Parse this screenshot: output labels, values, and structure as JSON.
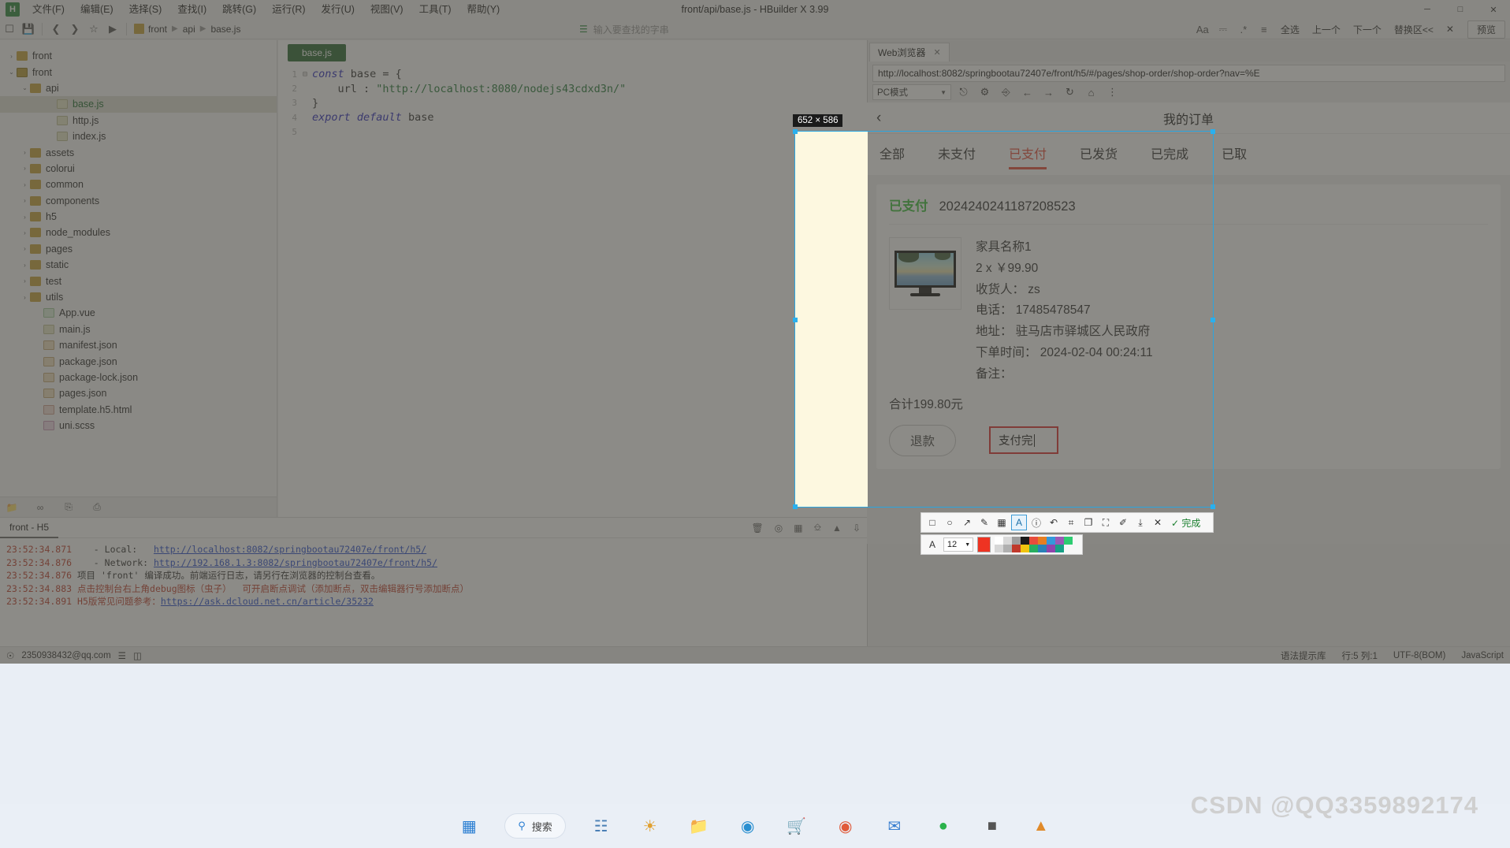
{
  "window": {
    "title": "front/api/base.js - HBuilder X 3.99",
    "logo_text": "H",
    "minimize": "─",
    "maximize": "□",
    "close": "✕"
  },
  "menubar": {
    "items": [
      {
        "label": "文件(F)"
      },
      {
        "label": "编辑(E)"
      },
      {
        "label": "选择(S)"
      },
      {
        "label": "查找(I)"
      },
      {
        "label": "跳转(G)"
      },
      {
        "label": "运行(R)"
      },
      {
        "label": "发行(U)"
      },
      {
        "label": "视图(V)"
      },
      {
        "label": "工具(T)"
      },
      {
        "label": "帮助(Y)"
      }
    ]
  },
  "toolbar": {
    "icons": [
      "new-file-icon",
      "save-icon",
      "back-icon",
      "forward-icon",
      "bookmark-icon",
      "run-icon"
    ],
    "breadcrumb": [
      "front",
      "api",
      "base.js"
    ],
    "search_placeholder": "输入要查找的字串",
    "match_case_icon": "match-case-icon",
    "whole_word_icon": "whole-word-icon",
    "regex_icon": "regex-icon",
    "in_selection_icon": "in-selection-icon",
    "select_all_label": "全选",
    "prev_label": "上一个",
    "next_label": "下一个",
    "replace_label": "替换区<<",
    "close_label": "✕",
    "preview_label": "预览"
  },
  "tree": {
    "items": [
      {
        "label": "front",
        "depth": 0,
        "arrow": "›",
        "icon": "f-folder",
        "sel": false
      },
      {
        "label": "front",
        "depth": 0,
        "arrow": "⌄",
        "icon": "f-proj",
        "sel": false
      },
      {
        "label": "api",
        "depth": 1,
        "arrow": "⌄",
        "icon": "f-folder",
        "sel": false
      },
      {
        "label": "base.js",
        "depth": 3,
        "arrow": "",
        "icon": "f-js",
        "sel": true
      },
      {
        "label": "http.js",
        "depth": 3,
        "arrow": "",
        "icon": "f-js",
        "sel": false
      },
      {
        "label": "index.js",
        "depth": 3,
        "arrow": "",
        "icon": "f-js",
        "sel": false
      },
      {
        "label": "assets",
        "depth": 1,
        "arrow": "›",
        "icon": "f-folder",
        "sel": false
      },
      {
        "label": "colorui",
        "depth": 1,
        "arrow": "›",
        "icon": "f-folder",
        "sel": false
      },
      {
        "label": "common",
        "depth": 1,
        "arrow": "›",
        "icon": "f-folder",
        "sel": false
      },
      {
        "label": "components",
        "depth": 1,
        "arrow": "›",
        "icon": "f-folder",
        "sel": false
      },
      {
        "label": "h5",
        "depth": 1,
        "arrow": "›",
        "icon": "f-folder",
        "sel": false
      },
      {
        "label": "node_modules",
        "depth": 1,
        "arrow": "›",
        "icon": "f-folder",
        "sel": false
      },
      {
        "label": "pages",
        "depth": 1,
        "arrow": "›",
        "icon": "f-folder",
        "sel": false
      },
      {
        "label": "static",
        "depth": 1,
        "arrow": "›",
        "icon": "f-folder",
        "sel": false
      },
      {
        "label": "test",
        "depth": 1,
        "arrow": "›",
        "icon": "f-folder",
        "sel": false
      },
      {
        "label": "utils",
        "depth": 1,
        "arrow": "›",
        "icon": "f-folder",
        "sel": false
      },
      {
        "label": "App.vue",
        "depth": 2,
        "arrow": "",
        "icon": "f-vue",
        "sel": false
      },
      {
        "label": "main.js",
        "depth": 2,
        "arrow": "",
        "icon": "f-js",
        "sel": false
      },
      {
        "label": "manifest.json",
        "depth": 2,
        "arrow": "",
        "icon": "f-json",
        "sel": false
      },
      {
        "label": "package.json",
        "depth": 2,
        "arrow": "",
        "icon": "f-json",
        "sel": false
      },
      {
        "label": "package-lock.json",
        "depth": 2,
        "arrow": "",
        "icon": "f-json",
        "sel": false
      },
      {
        "label": "pages.json",
        "depth": 2,
        "arrow": "",
        "icon": "f-json",
        "sel": false
      },
      {
        "label": "template.h5.html",
        "depth": 2,
        "arrow": "",
        "icon": "f-html",
        "sel": false
      },
      {
        "label": "uni.scss",
        "depth": 2,
        "arrow": "",
        "icon": "f-scss",
        "sel": false
      }
    ],
    "footer_icons": [
      "folder-open-icon",
      "link-icon",
      "copy-icon",
      "filter-icon"
    ]
  },
  "editor": {
    "tab_label": "base.js",
    "lines": [
      {
        "n": "1",
        "fold": "⊟",
        "segs": [
          {
            "t": "const ",
            "c": "kw"
          },
          {
            "t": "base = {",
            "c": "pl"
          }
        ]
      },
      {
        "n": "2",
        "fold": "",
        "segs": [
          {
            "t": "    url : ",
            "c": "pl"
          },
          {
            "t": "\"http://localhost:8080/nodejs43cdxd3n/\"",
            "c": "str"
          }
        ]
      },
      {
        "n": "3",
        "fold": "",
        "segs": [
          {
            "t": "}",
            "c": "pl"
          }
        ]
      },
      {
        "n": "4",
        "fold": "",
        "segs": [
          {
            "t": "export ",
            "c": "kw"
          },
          {
            "t": "default ",
            "c": "kw"
          },
          {
            "t": "base",
            "c": "pl"
          }
        ]
      },
      {
        "n": "5",
        "fold": "",
        "segs": [
          {
            "t": "",
            "c": "pl"
          }
        ]
      }
    ]
  },
  "console": {
    "tab_label": "front - H5",
    "right_icons": [
      "trash-icon",
      "stop-icon",
      "grid-icon",
      "export-icon",
      "collapse-icon",
      "sort-icon"
    ],
    "logs": [
      {
        "ts": "23:52:34.871",
        "parts": [
          {
            "t": "   - Local:   ",
            "c": "ln-lbl"
          },
          {
            "t": "http://localhost:8082/springbootau72407e/front/h5/",
            "c": "link"
          }
        ]
      },
      {
        "ts": "23:52:34.876",
        "parts": [
          {
            "t": "   - Network: ",
            "c": "ln-lbl"
          },
          {
            "t": "http://192.168.1.3:8082/springbootau72407e/front/h5/",
            "c": "link"
          }
        ]
      },
      {
        "ts": "23:52:34.876",
        "parts": [
          {
            "t": "项目 'front' 编译成功。前端运行日志，请另行在浏览器的控制台查看。",
            "c": "cn-dark"
          }
        ]
      },
      {
        "ts": "23:52:34.883",
        "parts": [
          {
            "t": "点击控制台右上角debug图标（虫子）  可开启断点调试（添加断点，双击编辑器行号添加断点）",
            "c": "cn-red"
          }
        ]
      },
      {
        "ts": "23:52:34.891",
        "parts": [
          {
            "t": "H5版常见问题参考：",
            "c": "cn-red"
          },
          {
            "t": "https://ask.dcloud.net.cn/article/35232",
            "c": "link"
          }
        ]
      }
    ]
  },
  "statusbar": {
    "account": "2350938432@qq.com",
    "left_icons": [
      "account-icon",
      "list-icon",
      "layout-icon"
    ],
    "right_items": [
      "语法提示库",
      "行:5 列:1",
      "UTF-8(BOM)",
      "JavaScript"
    ]
  },
  "browser": {
    "tab_label": "Web浏览器",
    "tab_close": "✕",
    "url": "http://localhost:8082/springbootau72407e/front/h5/#/pages/shop-order/shop-order?nav=%E",
    "mode_label": "PC模式",
    "toolbar_icons": [
      "device-icon",
      "gear-icon",
      "console-icon",
      "back-icon",
      "forward-icon",
      "reload-icon",
      "home-icon",
      "more-icon"
    ]
  },
  "capture": {
    "size_badge": "652 × 586"
  },
  "h5": {
    "back_icon": "‹",
    "title": "我的订单",
    "tabs": [
      {
        "label": "全部",
        "active": false
      },
      {
        "label": "未支付",
        "active": false
      },
      {
        "label": "已支付",
        "active": true
      },
      {
        "label": "已发货",
        "active": false
      },
      {
        "label": "已完成",
        "active": false
      },
      {
        "label": "已取",
        "active": false
      }
    ],
    "order": {
      "status": "已支付",
      "number": "2024240241187208523",
      "product_name": "家具名称1",
      "qty_price": "2 x ￥99.90",
      "receiver": "收货人： zs",
      "phone": "电话： 17485478547",
      "address": "地址： 驻马店市驿城区人民政府",
      "order_time": "下单时间： 2024-02-04 00:24:11",
      "remark": "备注：",
      "total": "合计199.80元",
      "refund_button": "退款",
      "annotation_text": "支付完"
    }
  },
  "annotation_toolbar": {
    "tools": [
      {
        "name": "rect-tool",
        "glyph": "□",
        "active": false
      },
      {
        "name": "ellipse-tool",
        "glyph": "○",
        "active": false
      },
      {
        "name": "arrow-tool",
        "glyph": "↗",
        "active": false
      },
      {
        "name": "pen-tool",
        "glyph": "✎",
        "active": false
      },
      {
        "name": "mosaic-tool",
        "glyph": "▦",
        "active": false
      },
      {
        "name": "text-tool",
        "glyph": "A",
        "active": true
      },
      {
        "name": "info-tool",
        "glyph": "ⓘ",
        "active": false
      },
      {
        "name": "undo-tool",
        "glyph": "↶",
        "active": false
      },
      {
        "name": "ocr-tool",
        "glyph": "⌗",
        "active": false
      },
      {
        "name": "copy-tool",
        "glyph": "❐",
        "active": false
      },
      {
        "name": "expand-tool",
        "glyph": "⛶",
        "active": false
      },
      {
        "name": "pin-tool",
        "glyph": "✐",
        "active": false
      },
      {
        "name": "download-tool",
        "glyph": "⤓",
        "active": false
      },
      {
        "name": "cancel-tool",
        "glyph": "✕",
        "active": false
      }
    ],
    "done_label": "完成",
    "done_check": "✓",
    "font_icon": "A",
    "font_size": "12",
    "current_color": "#ee3322",
    "palette": [
      "#ffffff",
      "#d9d9d9",
      "#9e9e9e",
      "#1a1a1a",
      "#e74c3c",
      "#e67e22",
      "#3498db",
      "#9b59b6",
      "#2ecc71",
      "#d6d6d6",
      "#b0b0b0",
      "#c0392b",
      "#f1c40f",
      "#27ae60",
      "#2980b9",
      "#8e44ad",
      "#16a085"
    ]
  },
  "taskbar": {
    "search_label": "搜索",
    "items": [
      "start-icon",
      "search-icon",
      "taskview-icon",
      "widgets-icon",
      "explorer-icon",
      "edge-icon",
      "store-icon",
      "chrome-icon",
      "mail-icon",
      "wechat-icon",
      "terminal-icon",
      "hbuilder-icon"
    ]
  },
  "watermark": "CSDN @QQ3359892174"
}
